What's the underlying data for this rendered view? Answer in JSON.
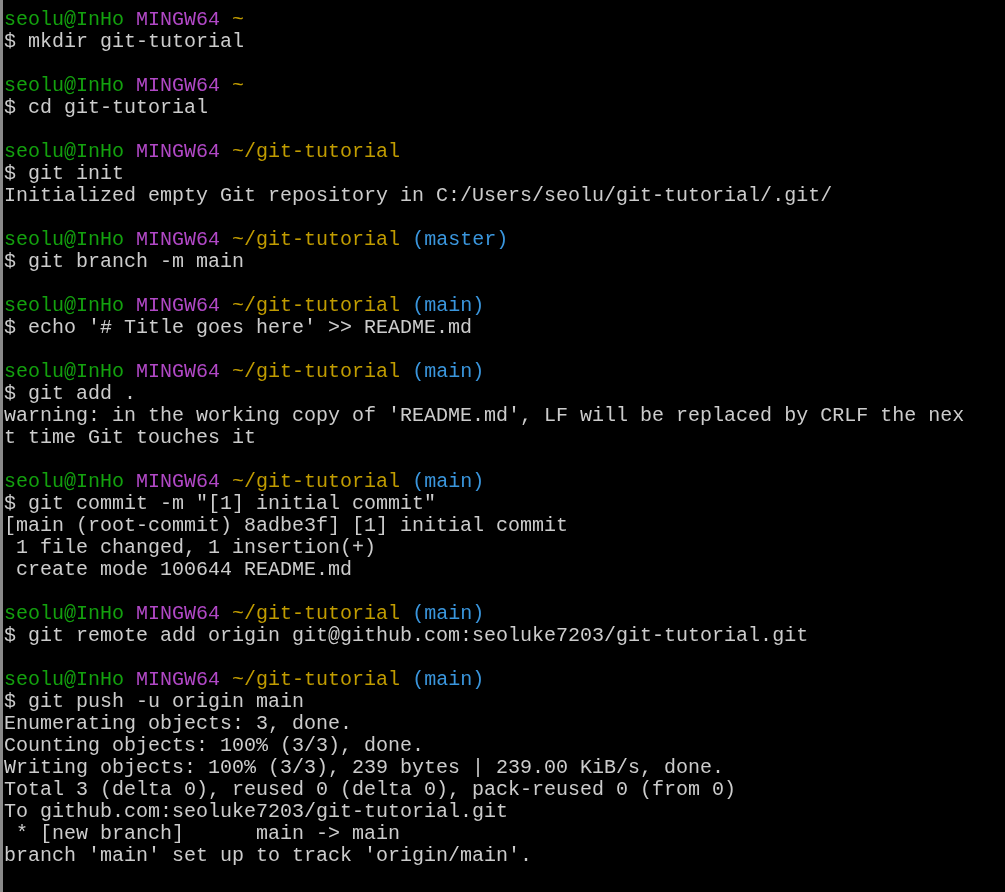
{
  "terminal": {
    "blocks": [
      {
        "prompt": {
          "user_host": "seolu@InHo",
          "system": "MINGW64",
          "path": "~"
        },
        "command": "$ mkdir git-tutorial"
      },
      {
        "prompt": {
          "user_host": "seolu@InHo",
          "system": "MINGW64",
          "path": "~"
        },
        "command": "$ cd git-tutorial"
      },
      {
        "prompt": {
          "user_host": "seolu@InHo",
          "system": "MINGW64",
          "path": "~/git-tutorial"
        },
        "command": "$ git init",
        "output": [
          "Initialized empty Git repository in C:/Users/seolu/git-tutorial/.git/"
        ]
      },
      {
        "prompt": {
          "user_host": "seolu@InHo",
          "system": "MINGW64",
          "path": "~/git-tutorial",
          "branch": "(master)"
        },
        "command": "$ git branch -m main"
      },
      {
        "prompt": {
          "user_host": "seolu@InHo",
          "system": "MINGW64",
          "path": "~/git-tutorial",
          "branch": "(main)"
        },
        "command": "$ echo '# Title goes here' >> README.md"
      },
      {
        "prompt": {
          "user_host": "seolu@InHo",
          "system": "MINGW64",
          "path": "~/git-tutorial",
          "branch": "(main)"
        },
        "command": "$ git add .",
        "output": [
          "warning: in the working copy of 'README.md', LF will be replaced by CRLF the nex",
          "t time Git touches it"
        ]
      },
      {
        "prompt": {
          "user_host": "seolu@InHo",
          "system": "MINGW64",
          "path": "~/git-tutorial",
          "branch": "(main)"
        },
        "command": "$ git commit -m \"[1] initial commit\"",
        "output": [
          "[main (root-commit) 8adbe3f] [1] initial commit",
          " 1 file changed, 1 insertion(+)",
          " create mode 100644 README.md"
        ]
      },
      {
        "prompt": {
          "user_host": "seolu@InHo",
          "system": "MINGW64",
          "path": "~/git-tutorial",
          "branch": "(main)"
        },
        "command": "$ git remote add origin git@github.com:seoluke7203/git-tutorial.git"
      },
      {
        "prompt": {
          "user_host": "seolu@InHo",
          "system": "MINGW64",
          "path": "~/git-tutorial",
          "branch": "(main)"
        },
        "command": "$ git push -u origin main",
        "output": [
          "Enumerating objects: 3, done.",
          "Counting objects: 100% (3/3), done.",
          "Writing objects: 100% (3/3), 239 bytes | 239.00 KiB/s, done.",
          "Total 3 (delta 0), reused 0 (delta 0), pack-reused 0 (from 0)",
          "To github.com:seoluke7203/git-tutorial.git",
          " * [new branch]      main -> main",
          "branch 'main' set up to track 'origin/main'."
        ]
      }
    ]
  }
}
